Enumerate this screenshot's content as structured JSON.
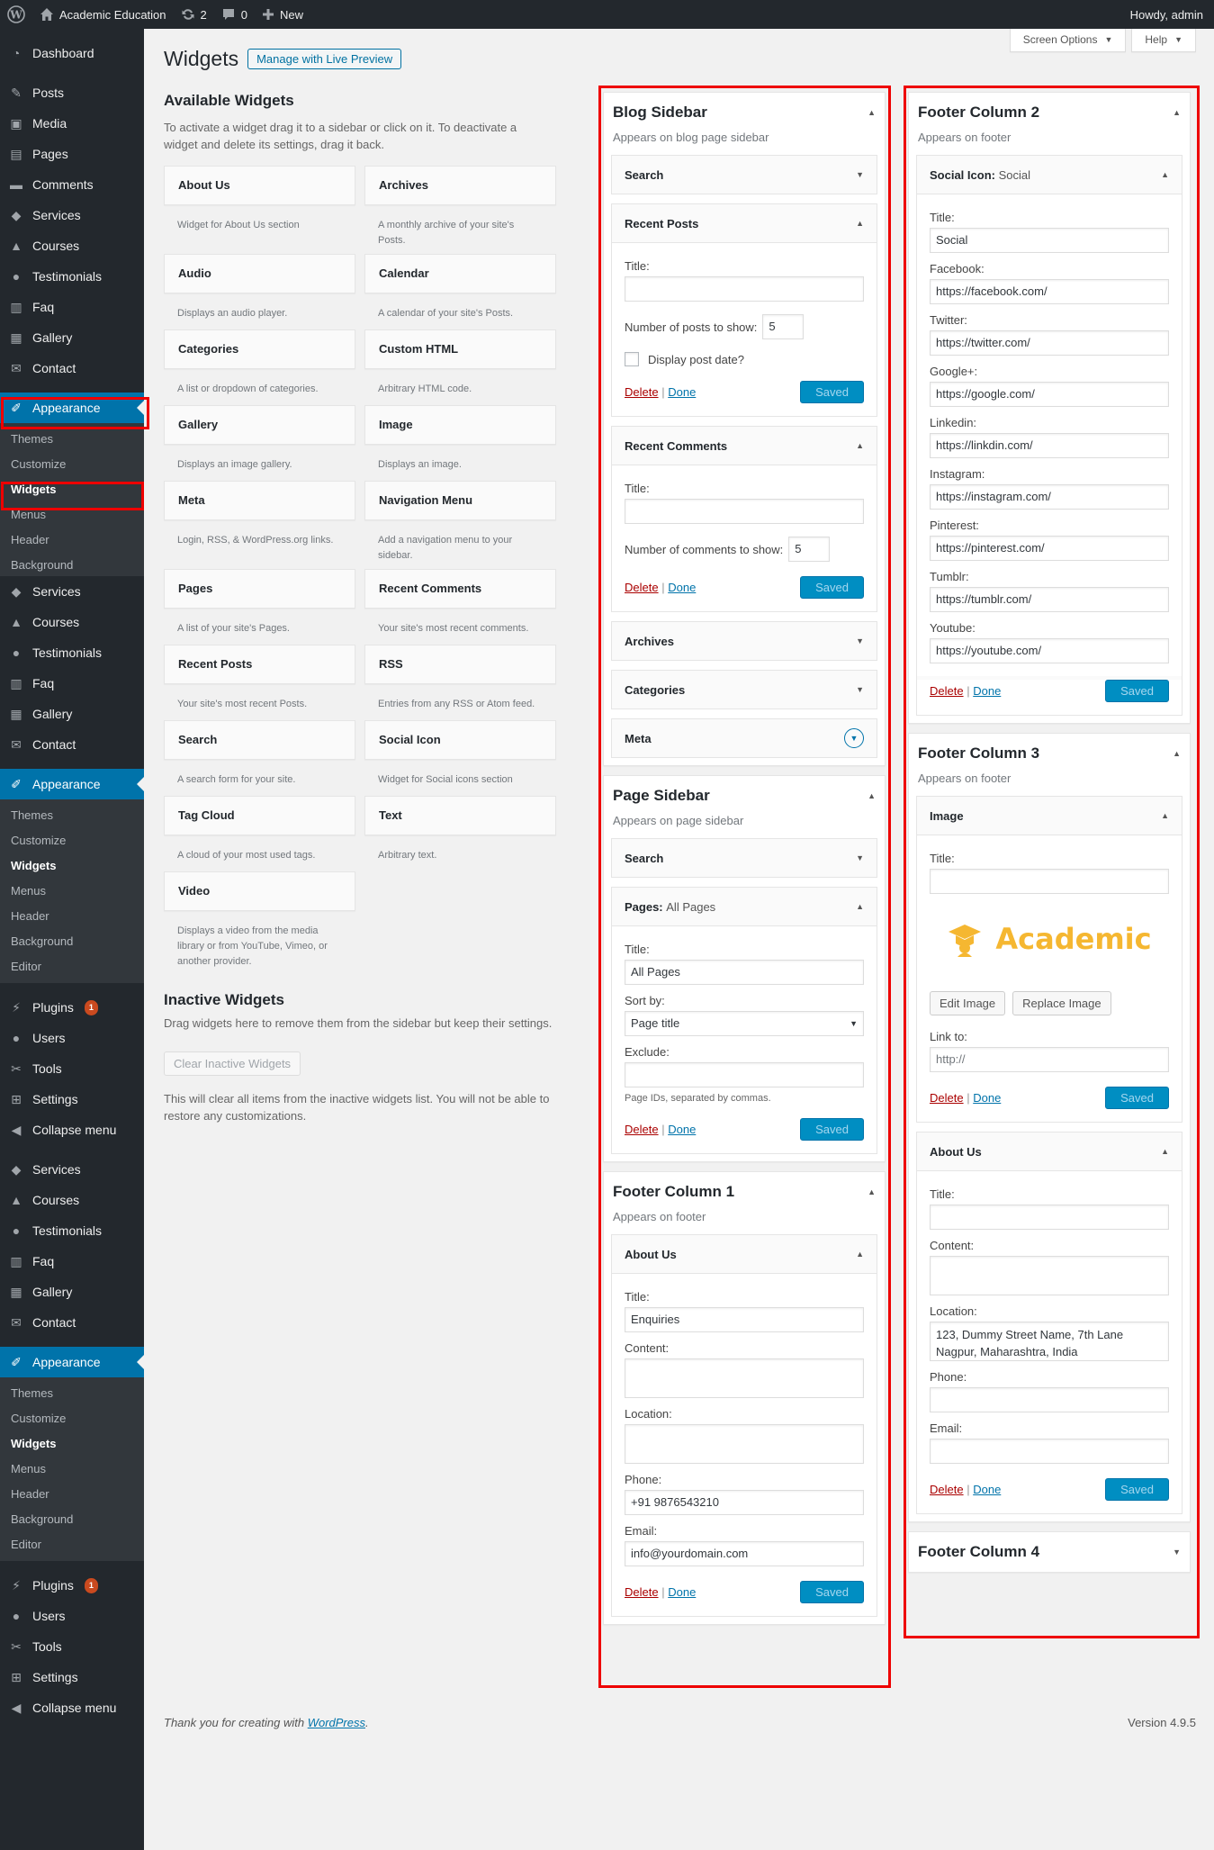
{
  "adminbar": {
    "site": "Academic Education",
    "updates": "2",
    "comments": "0",
    "new": "New",
    "howdy": "Howdy, admin"
  },
  "top": {
    "screen_options": "Screen Options",
    "help": "Help"
  },
  "page": {
    "title": "Widgets",
    "preview": "Manage with Live Preview"
  },
  "menu": {
    "dashboard": "Dashboard",
    "posts": "Posts",
    "media": "Media",
    "pages": "Pages",
    "comments": "Comments",
    "services": "Services",
    "courses": "Courses",
    "testimonials": "Testimonials",
    "faq": "Faq",
    "gallery": "Gallery",
    "contact": "Contact",
    "appearance": "Appearance",
    "themes": "Themes",
    "customize": "Customize",
    "widgets": "Widgets",
    "menus": "Menus",
    "header": "Header",
    "background": "Background",
    "editor": "Editor",
    "plugins": "Plugins",
    "plugins_badge": "1",
    "users": "Users",
    "tools": "Tools",
    "settings": "Settings",
    "collapse": "Collapse menu"
  },
  "available": {
    "title": "Available Widgets",
    "desc": "To activate a widget drag it to a sidebar or click on it. To deactivate a widget and delete its settings, drag it back.",
    "widgets": [
      {
        "name": "About Us",
        "desc": "Widget for About Us section"
      },
      {
        "name": "Archives",
        "desc": "A monthly archive of your site's Posts."
      },
      {
        "name": "Audio",
        "desc": "Displays an audio player."
      },
      {
        "name": "Calendar",
        "desc": "A calendar of your site's Posts."
      },
      {
        "name": "Categories",
        "desc": "A list or dropdown of categories."
      },
      {
        "name": "Custom HTML",
        "desc": "Arbitrary HTML code."
      },
      {
        "name": "Gallery",
        "desc": "Displays an image gallery."
      },
      {
        "name": "Image",
        "desc": "Displays an image."
      },
      {
        "name": "Meta",
        "desc": "Login, RSS, & WordPress.org links."
      },
      {
        "name": "Navigation Menu",
        "desc": "Add a navigation menu to your sidebar."
      },
      {
        "name": "Pages",
        "desc": "A list of your site's Pages."
      },
      {
        "name": "Recent Comments",
        "desc": "Your site's most recent comments."
      },
      {
        "name": "Recent Posts",
        "desc": "Your site's most recent Posts."
      },
      {
        "name": "RSS",
        "desc": "Entries from any RSS or Atom feed."
      },
      {
        "name": "Search",
        "desc": "A search form for your site."
      },
      {
        "name": "Social Icon",
        "desc": "Widget for Social icons section"
      },
      {
        "name": "Tag Cloud",
        "desc": "A cloud of your most used tags."
      },
      {
        "name": "Text",
        "desc": "Arbitrary text."
      },
      {
        "name": "Video",
        "desc": "Displays a video from the media library or from YouTube, Vimeo, or another provider."
      }
    ]
  },
  "inactive": {
    "title": "Inactive Widgets",
    "desc": "Drag widgets here to remove them from the sidebar but keep their settings.",
    "button": "Clear Inactive Widgets",
    "note": "This will clear all items from the inactive widgets list. You will not be able to restore any customizations."
  },
  "common": {
    "title": "Title:",
    "delete": "Delete",
    "done": "Done",
    "saved": "Saved",
    "sep": "|",
    "content": "Content:",
    "location": "Location:",
    "phone": "Phone:",
    "email": "Email:"
  },
  "blog": {
    "title": "Blog Sidebar",
    "desc": "Appears on blog page sidebar",
    "search": "Search",
    "recent_posts": "Recent Posts",
    "num_posts": "Number of posts to show:",
    "num_posts_val": "5",
    "show_date": "Display post date?",
    "recent_comments": "Recent Comments",
    "num_comments": "Number of comments to show:",
    "num_comments_val": "5",
    "archives": "Archives",
    "categories": "Categories",
    "meta": "Meta"
  },
  "pagesb": {
    "title": "Page Sidebar",
    "desc": "Appears on page sidebar",
    "search": "Search",
    "pages_w": "Pages:",
    "pages_in": "All Pages",
    "title_val": "All Pages",
    "sort": "Sort by:",
    "sort_val": "Page title",
    "exclude": "Exclude:",
    "hint": "Page IDs, separated by commas."
  },
  "f1": {
    "title": "Footer Column 1",
    "desc": "Appears on footer",
    "widget": "About Us",
    "title_val": "Enquiries",
    "phone_val": "+91 9876543210",
    "email_val": "info@yourdomain.com"
  },
  "f2": {
    "title": "Footer Column 2",
    "desc": "Appears on footer",
    "widget": "Social Icon:",
    "widget_in": "Social",
    "title_val": "Social",
    "fields": [
      {
        "label": "Facebook:",
        "value": "https://facebook.com/"
      },
      {
        "label": "Twitter:",
        "value": "https://twitter.com/"
      },
      {
        "label": "Google+:",
        "value": "https://google.com/"
      },
      {
        "label": "Linkedin:",
        "value": "https://linkdin.com/"
      },
      {
        "label": "Instagram:",
        "value": "https://instagram.com/"
      },
      {
        "label": "Pinterest:",
        "value": "https://pinterest.com/"
      },
      {
        "label": "Tumblr:",
        "value": "https://tumblr.com/"
      },
      {
        "label": "Youtube:",
        "value": "https://youtube.com/"
      }
    ]
  },
  "f3": {
    "title": "Footer Column 3",
    "desc": "Appears on footer",
    "image_w": "Image",
    "logo_text": "Academic",
    "edit_image": "Edit Image",
    "replace_image": "Replace Image",
    "link_to": "Link to:",
    "link_ph": "http://",
    "about_w": "About Us",
    "loc_val": "123, Dummy Street Name, 7th Lane Nagpur, Maharashtra, India"
  },
  "f4": {
    "title": "Footer Column 4"
  },
  "footer": {
    "thanks": "Thank you for creating with",
    "wp": "WordPress",
    "dot": ".",
    "version": "Version 4.9.5"
  },
  "colors": {
    "accent": "#0073aa",
    "highlight": "#e00000",
    "logo": "#f5b731"
  }
}
